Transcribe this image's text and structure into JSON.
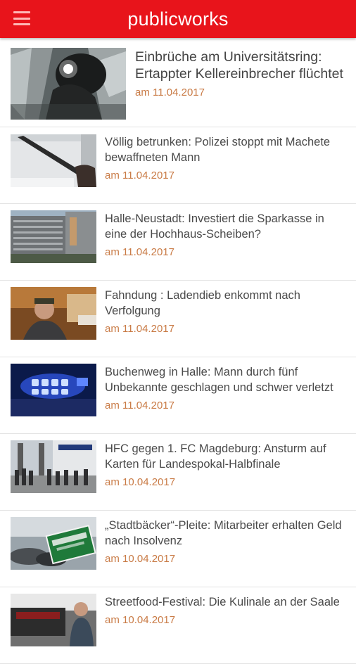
{
  "app": {
    "title": "publicworks",
    "menu_icon": "hamburger-menu-icon",
    "brand_color": "#e8141b",
    "date_color": "#c97b46"
  },
  "articles": [
    {
      "headline": "Einbrüche am Universitätsring: Ertappter Kellereinbrecher flüchtet",
      "date": "am 11.04.2017",
      "image": "burglar-flashlight-photo"
    },
    {
      "headline": "Völlig betrunken: Polizei stoppt mit Machete bewaffneten Mann",
      "date": "am 11.04.2017",
      "image": "machete-photo"
    },
    {
      "headline": "Halle-Neustadt: Investiert die Sparkasse in eine der Hochhaus-Scheiben?",
      "date": "am 11.04.2017",
      "image": "highrise-building-photo"
    },
    {
      "headline": "Fahndung : Ladendieb enkommt nach Verfolgung",
      "date": "am 11.04.2017",
      "image": "shoplifter-photo"
    },
    {
      "headline": "Buchenweg in Halle: Mann durch fünf Unbekannte geschlagen und schwer verletzt",
      "date": "am 11.04.2017",
      "image": "police-blue-light-photo"
    },
    {
      "headline": "HFC gegen 1. FC Magdeburg: Ansturm auf Karten für Landespokal-Halbfinale",
      "date": "am 10.04.2017",
      "image": "ticket-queue-photo"
    },
    {
      "headline": "„Stadtbäcker“-Pleite: Mitarbeiter erhalten Geld nach Insolvenz",
      "date": "am 10.04.2017",
      "image": "bakery-sign-photo"
    },
    {
      "headline": "Streetfood-Festival: Die Kulinale an der Saale",
      "date": "am 10.04.2017",
      "image": "streetfood-festival-photo"
    }
  ]
}
